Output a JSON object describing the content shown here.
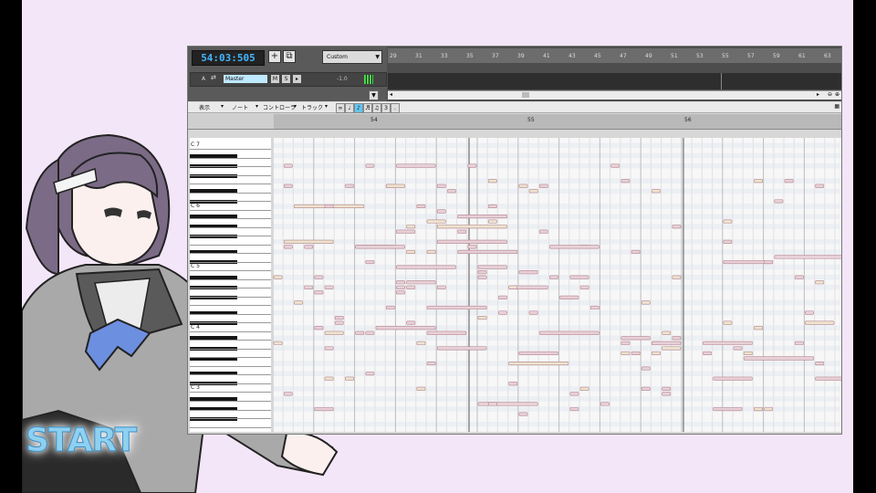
{
  "toolbar": {
    "time": "54:03:505",
    "add_icon": "+",
    "preset": "Custom"
  },
  "track": {
    "letter": "A",
    "name": "Master",
    "mute": "M",
    "solo": "S",
    "volume": "-1.0"
  },
  "ruler": [
    "29",
    "31",
    "33",
    "35",
    "37",
    "39",
    "41",
    "43",
    "45",
    "47",
    "49",
    "51",
    "53",
    "55",
    "57",
    "59",
    "61",
    "63"
  ],
  "menu": {
    "view": "表示",
    "note": "ノート",
    "controller": "コントローラ",
    "track": "トラック",
    "quant": "3"
  },
  "measures": [
    "54",
    "55",
    "56"
  ],
  "keys": [
    "C 7",
    "C 6",
    "C 5",
    "C 4",
    "C 3",
    "C 2"
  ],
  "start_label": "START",
  "colors": {
    "background": "#f4e6f9",
    "time_text": "#43b6ff",
    "note_fill": "#e7d0d6",
    "note_border": "#b58593"
  }
}
